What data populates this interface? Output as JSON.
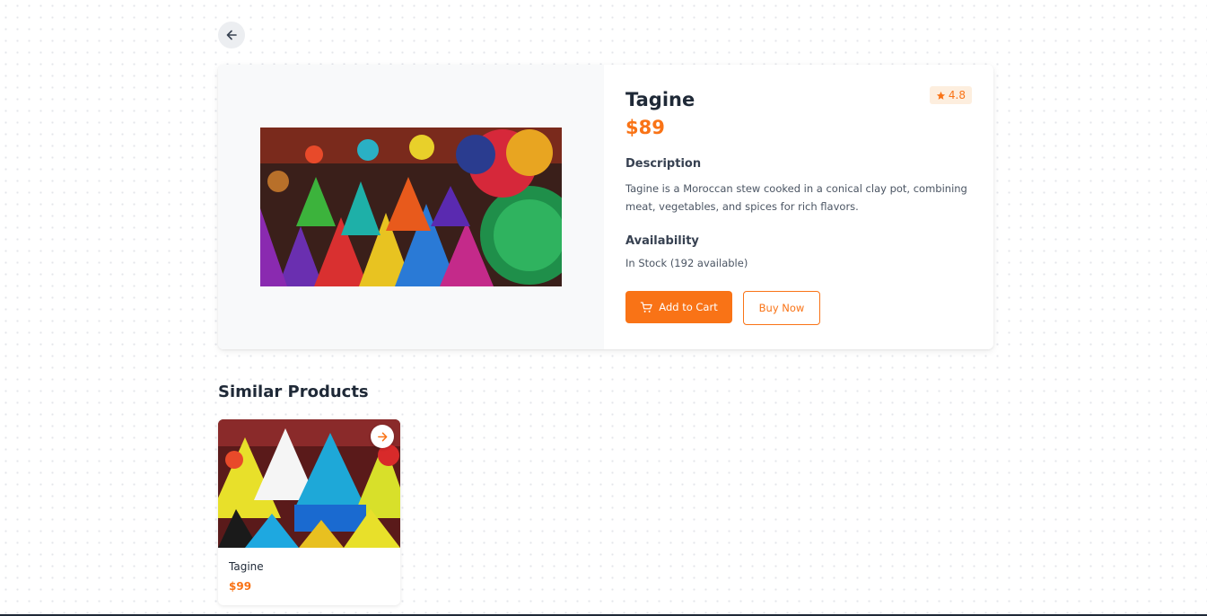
{
  "colors": {
    "accent": "#f97316",
    "rating_bg": "#fdeede",
    "text": "#1f2937",
    "muted": "#4b5563"
  },
  "nav": {
    "back_icon": "arrow-left-icon"
  },
  "product": {
    "title": "Tagine",
    "price": "$89",
    "rating": "4.8",
    "rating_icon": "star-icon",
    "description_label": "Description",
    "description": "Tagine is a Moroccan stew cooked in a conical clay pot, combining meat, vegetables, and spices for rich flavors.",
    "availability_label": "Availability",
    "availability": "In Stock (192 available)",
    "add_to_cart_label": "Add to Cart",
    "add_to_cart_icon": "cart-icon",
    "buy_now_label": "Buy Now"
  },
  "similar": {
    "heading": "Similar Products",
    "items": [
      {
        "name": "Tagine",
        "price": "$99",
        "open_icon": "arrow-right-icon"
      }
    ]
  }
}
